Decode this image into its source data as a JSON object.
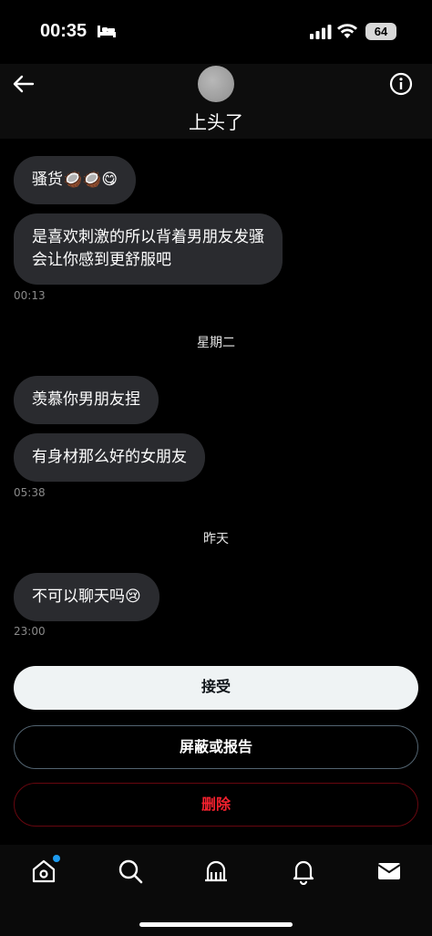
{
  "status_bar": {
    "time": "00:35",
    "battery": "64"
  },
  "header": {
    "title": "上头了"
  },
  "messages": [
    {
      "text": "骚货🥥🥥😋"
    },
    {
      "line1": "是喜欢刺激的所以背着男朋友发骚",
      "line2": "会让你感到更舒服吧",
      "time": "00:13"
    },
    {
      "date": "星期二"
    },
    {
      "text": "羡慕你男朋友捏"
    },
    {
      "text": "有身材那么好的女朋友",
      "time": "05:38"
    },
    {
      "date": "昨天"
    },
    {
      "text": "不可以聊天吗😢",
      "time": "23:00"
    }
  ],
  "actions": {
    "accept": "接受",
    "block_report": "屏蔽或报告",
    "delete": "删除"
  },
  "colors": {
    "accept_bg": "#eff3f4",
    "delete_text": "#f4212e",
    "bubble_bg": "#2a2b2f",
    "notification_dot": "#1d9bf0"
  },
  "nav": [
    "home-icon",
    "search-icon",
    "grok-icon",
    "bell-icon",
    "mail-icon"
  ]
}
